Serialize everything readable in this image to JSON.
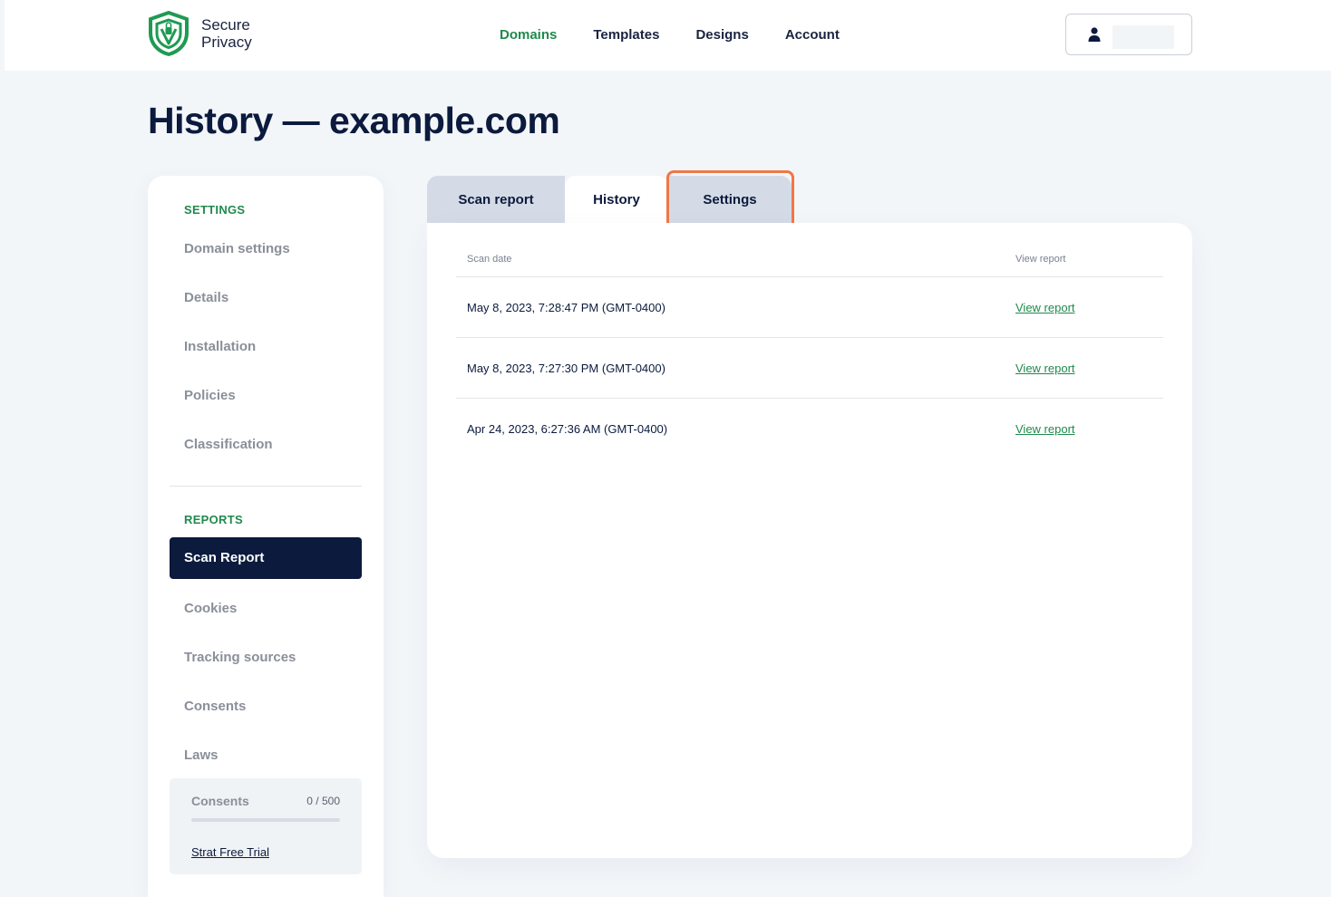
{
  "header": {
    "logo_line1": "Secure",
    "logo_line2": "Privacy",
    "nav": [
      {
        "label": "Domains",
        "active": true
      },
      {
        "label": "Templates",
        "active": false
      },
      {
        "label": "Designs",
        "active": false
      },
      {
        "label": "Account",
        "active": false
      }
    ],
    "user_icon": "user-icon"
  },
  "page": {
    "title": "History — example.com"
  },
  "sidebar": {
    "settings_label": "SETTINGS",
    "settings_items": [
      "Domain settings",
      "Details",
      "Installation",
      "Policies",
      "Classification"
    ],
    "reports_label": "REPORTS",
    "active_item": "Scan Report",
    "reports_items": [
      "Cookies",
      "Tracking sources",
      "Consents",
      "Laws"
    ],
    "consent_card": {
      "title": "Consents",
      "count": "0 / 500",
      "progress": 0,
      "link": "Strat Free Trial"
    }
  },
  "tabs": [
    {
      "label": "Scan report",
      "active": false
    },
    {
      "label": "History",
      "active": true
    },
    {
      "label": "Settings",
      "active": false,
      "highlighted": true
    }
  ],
  "table": {
    "headers": {
      "date": "Scan date",
      "view": "View report"
    },
    "rows": [
      {
        "date": "May 8, 2023, 7:28:47 PM (GMT-0400)",
        "link": "View report"
      },
      {
        "date": "May 8, 2023, 7:27:30 PM (GMT-0400)",
        "link": "View report"
      },
      {
        "date": "Apr 24, 2023, 6:27:36 AM (GMT-0400)",
        "link": "View report"
      }
    ]
  },
  "colors": {
    "accent_green": "#1f8a4d",
    "navy": "#0b1a3d",
    "highlight_orange": "#f07747"
  }
}
